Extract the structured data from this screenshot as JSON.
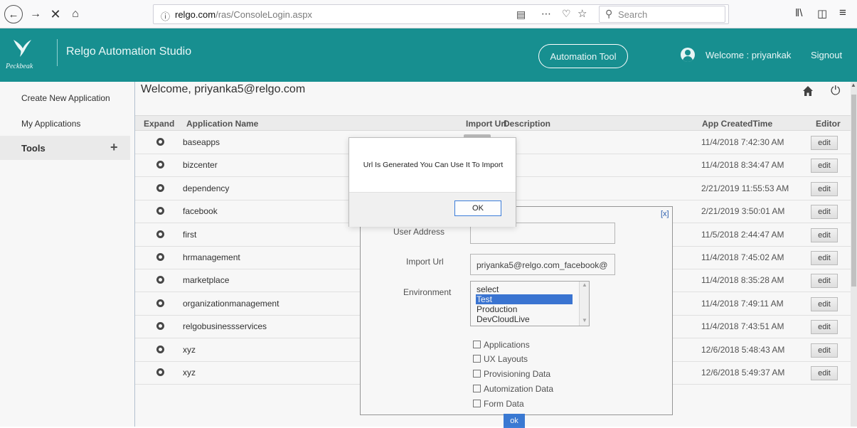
{
  "browser": {
    "url_domain": "relgo.com",
    "url_path": "/ras/ConsoleLogin.aspx",
    "search_placeholder": "Search"
  },
  "header": {
    "logo_text": "Peckbeak",
    "app_title": "Relgo Automation Studio",
    "automation_tool_label": "Automation Tool",
    "welcome_user": "Welcome : priyankak",
    "signout_label": "Signout"
  },
  "sidebar": {
    "items": [
      {
        "label": "Create New Application"
      },
      {
        "label": "My Applications"
      },
      {
        "label": "Tools"
      }
    ]
  },
  "main": {
    "welcome": "Welcome, priyanka5@relgo.com"
  },
  "table": {
    "columns": [
      "Expand",
      "Application Name",
      "Import Url",
      "Description",
      "App CreatedTime",
      "Editor"
    ],
    "edit_label": "edit",
    "rows": [
      {
        "name": "baseapps",
        "time": "11/4/2018 7:42:30 AM"
      },
      {
        "name": "bizcenter",
        "time": "11/4/2018 8:34:47 AM"
      },
      {
        "name": "dependency",
        "time": "2/21/2019 11:55:53 AM"
      },
      {
        "name": "facebook",
        "time": "2/21/2019 3:50:01 AM"
      },
      {
        "name": "first",
        "time": "11/5/2018 2:44:47 AM"
      },
      {
        "name": "hrmanagement",
        "time": "11/4/2018 7:45:02 AM"
      },
      {
        "name": "marketplace",
        "time": "11/4/2018 8:35:28 AM"
      },
      {
        "name": "organizationmanagement",
        "time": "11/4/2018 7:49:11 AM"
      },
      {
        "name": "relgobusinessservices",
        "time": "11/4/2018 7:43:51 AM"
      },
      {
        "name": "xyz",
        "time": "12/6/2018 5:48:43 AM"
      },
      {
        "name": "xyz",
        "time": "12/6/2018 5:49:37 AM"
      }
    ]
  },
  "panel": {
    "close_label": "[x]",
    "user_address_label": "User Address",
    "import_url_label": "Import Url",
    "import_url_value": "priyanka5@relgo.com_facebook@",
    "environment_label": "Environment",
    "environment_options": [
      "select",
      "Test",
      "Production",
      "DevCloudLive"
    ],
    "environment_selected": "Test",
    "checkboxes": [
      "Applications",
      "UX Layouts",
      "Provisioning Data",
      "Automization Data",
      "Form Data"
    ],
    "ok_label": "ok"
  },
  "alert": {
    "message": "Url Is Generated You Can Use It To Import",
    "ok_label": "OK"
  },
  "colors": {
    "header_bg": "#178f90",
    "selection": "#3c78d8"
  }
}
